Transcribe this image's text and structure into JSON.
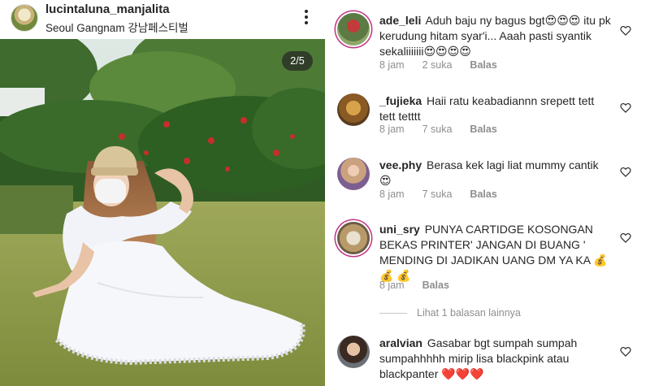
{
  "post": {
    "username": "lucintaluna_manjalita",
    "location": "Seoul Gangnam 강남페스티벌",
    "counter": "2/5",
    "icons": {
      "more": "more-vertical-icon"
    }
  },
  "comments": [
    {
      "username": "ade_leli",
      "text": "Aduh baju ny bagus bgt😍😍😍 itu pk kerudung hitam syar'i... Aaah pasti syantik sekaliiiiiii😍😍😍😍",
      "time": "8 jam",
      "likes": "2 suka",
      "reply": "Balas",
      "has_story": true
    },
    {
      "username": "_fujieka",
      "text": "Haii ratu keabadiannn srepett tett tett tetttt",
      "time": "8 jam",
      "likes": "7 suka",
      "reply": "Balas",
      "has_story": false
    },
    {
      "username": "vee.phy",
      "text": "Berasa kek lagi liat mummy cantik 😍",
      "time": "8 jam",
      "likes": "7 suka",
      "reply": "Balas",
      "has_story": false
    },
    {
      "username": "uni_sry",
      "text": "PUNYA CARTIDGE KOSONGAN BEKAS PRINTER' JANGAN DI BUANG ' MENDING DI JADIKAN UANG DM YA KA 💰 💰 💰",
      "time": "8 jam",
      "likes": "",
      "reply": "Balas",
      "has_story": true
    },
    {
      "username": "aralvian",
      "text": "Gasabar bgt sumpah sumpah sumpahhhhh mirip lisa blackpink atau blackpanter ❤️❤️❤️",
      "time": "",
      "likes": "",
      "reply": "",
      "has_story": false
    }
  ],
  "more_replies": "Lihat 1 balasan lainnya",
  "colors": {
    "text": "#262626",
    "meta": "#8e8e8e",
    "story_ring": "#c13584"
  }
}
